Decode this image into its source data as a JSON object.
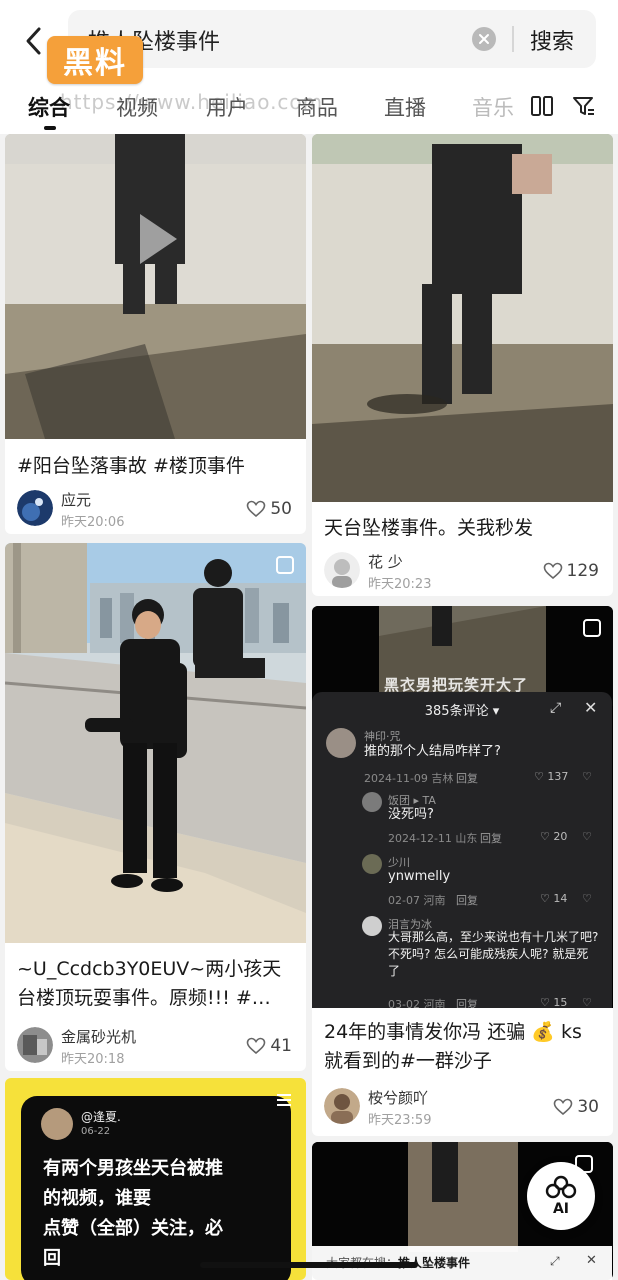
{
  "header": {
    "search_query": "推人坠楼事件",
    "search_button": "搜索",
    "watermark_badge": "黑料",
    "watermark_url": "https://www.heiliao.com"
  },
  "tabs": [
    {
      "label": "综合",
      "active": true
    },
    {
      "label": "视频"
    },
    {
      "label": "用户"
    },
    {
      "label": "商品"
    },
    {
      "label": "直播"
    },
    {
      "label": "音乐"
    }
  ],
  "cards": {
    "c1": {
      "title": "#阳台坠落事故 #楼顶事件",
      "author": "应元",
      "time": "昨天20:06",
      "likes": "50"
    },
    "c2": {
      "title": "天台坠楼事件。关我秒发",
      "author": "花 少",
      "time": "昨天20:23",
      "likes": "129"
    },
    "c3": {
      "title": "~U_Ccdcb3Y0EUV~两小孩天台楼顶玩耍事件。原频!!!  #…",
      "author": "金属砂光机",
      "time": "昨天20:18",
      "likes": "41"
    },
    "c4": {
      "title": "24年的事情发你冯 还骗 💰 ks 就看到的#一群沙子",
      "author": "桉兮颜吖",
      "time": "昨天23:59",
      "likes": "30",
      "overlay_caption": "黑衣男把玩笑开大了"
    },
    "c5": {
      "note_user": "@逢夏.",
      "note_date": "06-22",
      "note_lines": [
        "有两个男孩坐天台被推",
        "的视频，谁要",
        "点赞（全部）关注，必",
        "回"
      ]
    }
  },
  "comments": {
    "title": "385条评论 ▾",
    "items": [
      {
        "name": "神印·咒",
        "text": "推的那个人结局咋样了?",
        "meta": "2024-11-09 吉林",
        "reply": "回复",
        "likes": "137"
      },
      {
        "name": "饭团 ▸ TA",
        "text": "没死吗?",
        "meta": "2024-12-11 山东",
        "reply": "回复",
        "likes": "20"
      },
      {
        "name": "少川",
        "text": "ynwmelly",
        "meta": "02-07 河南",
        "reply": "回复",
        "likes": "14"
      },
      {
        "name": "泪言为冰",
        "text": "大哥那么高，至少来说也有十几米了吧? 不死吗? 怎么可能成残疾人呢? 就是死了",
        "meta": "03-02 河南",
        "reply": "回复",
        "likes": "15"
      }
    ]
  },
  "ai_button": "AI",
  "bottom_bar": {
    "prefix": "大家都在搜：",
    "keyword": "推人坠楼事件"
  },
  "colors": {
    "accent": "#f5a03a",
    "highlight_yellow": "#f6e13a"
  }
}
